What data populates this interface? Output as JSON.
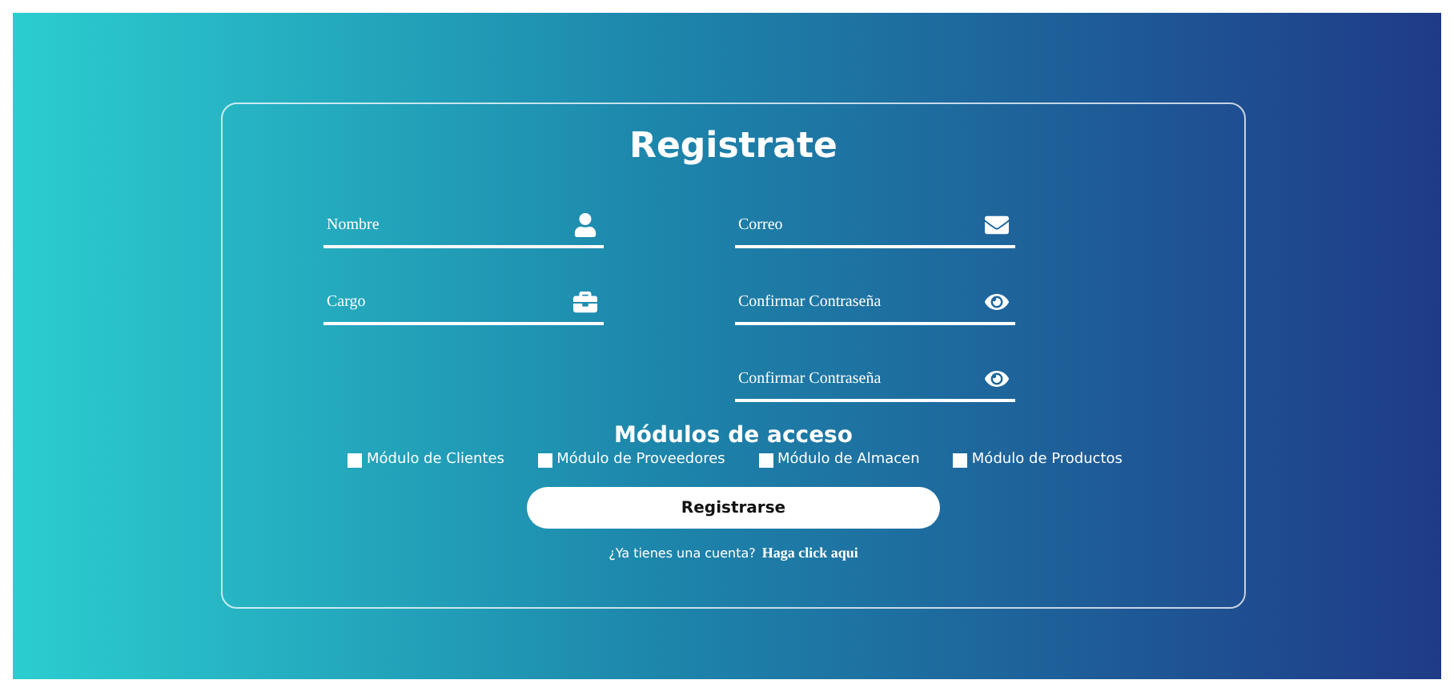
{
  "title": "Registrate",
  "field_columns": {
    "left": [
      {
        "placeholder": "Nombre",
        "kind": "user"
      },
      {
        "placeholder": "Cargo",
        "kind": "briefcase"
      }
    ],
    "right": [
      {
        "placeholder": "Correo",
        "kind": "mail"
      },
      {
        "placeholder": "Confirmar Contraseña",
        "kind": "eye"
      },
      {
        "placeholder": "Confirmar Contraseña",
        "kind": "eye"
      }
    ]
  },
  "modules": {
    "title": "Módulos de acceso",
    "options": [
      {
        "label": "Módulo de Clientes",
        "checked": false
      },
      {
        "label": "Módulo de Proveedores",
        "checked": false
      },
      {
        "label": "Módulo de Almacen",
        "checked": false
      },
      {
        "label": "Módulo de Productos",
        "checked": false
      }
    ]
  },
  "submit": "Registrarse",
  "footer": {
    "text": "¿Ya tienes una cuenta?",
    "link": "Haga click aqui"
  }
}
